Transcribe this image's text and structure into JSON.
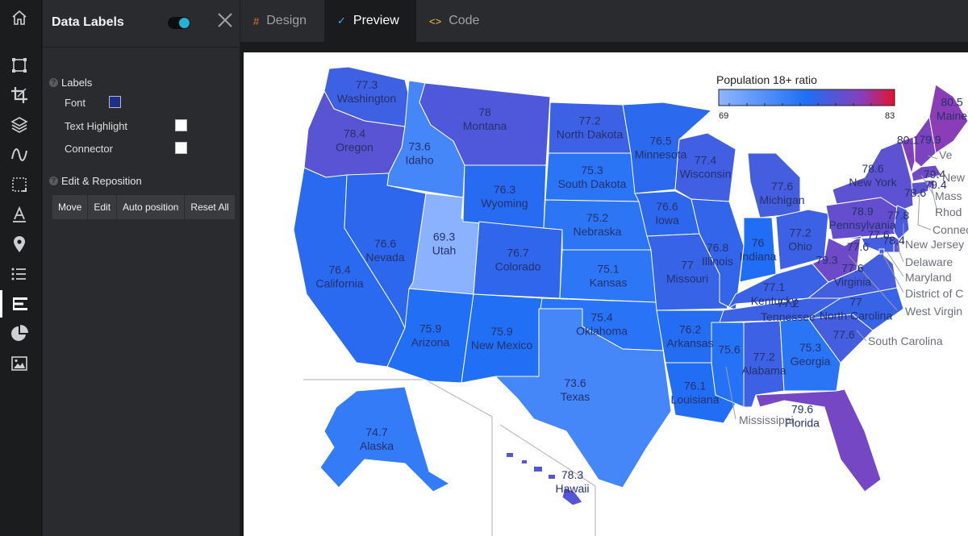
{
  "panel": {
    "title": "Data Labels",
    "toggle_on": true,
    "labels_section": "Labels",
    "font_label": "Font",
    "font_color": "#1f2f86",
    "text_highlight_label": "Text Highlight",
    "text_highlight_color": "#ffffff",
    "connector_label": "Connector",
    "connector_color": "#ffffff",
    "edit_section": "Edit & Reposition",
    "buttons": [
      "Move",
      "Edit",
      "Auto position",
      "Reset All"
    ]
  },
  "tabs": [
    {
      "label": "Design",
      "icon": "#",
      "icon_color": "#e8742a",
      "active": false
    },
    {
      "label": "Preview",
      "icon": "✓",
      "icon_color": "#3fa9f5",
      "active": true
    },
    {
      "label": "Code",
      "icon": "<>",
      "icon_color": "#f5c342",
      "active": false
    }
  ],
  "rail_icons": [
    "home-icon",
    "frame-icon",
    "crop-icon",
    "layers-icon",
    "curve-icon",
    "selection-icon",
    "text-icon",
    "pin-icon",
    "list-icon",
    "data-labels-icon",
    "pie-chart-icon",
    "image-icon"
  ],
  "legend": {
    "title": "Population 18+ ratio",
    "min": 69,
    "max": 83,
    "min_label": "69",
    "max_label": "83",
    "colors": [
      "#8fb5ff",
      "#1f6ef5",
      "#8a3db8",
      "#e8102a"
    ]
  },
  "states": [
    {
      "name": "Washington",
      "value": 77.3
    },
    {
      "name": "Oregon",
      "value": 78.4
    },
    {
      "name": "California",
      "value": 76.4
    },
    {
      "name": "Idaho",
      "value": 73.6
    },
    {
      "name": "Nevada",
      "value": 76.6
    },
    {
      "name": "Utah",
      "value": 69.3
    },
    {
      "name": "Arizona",
      "value": 75.9
    },
    {
      "name": "Montana",
      "value": 78
    },
    {
      "name": "Wyoming",
      "value": 76.3
    },
    {
      "name": "Colorado",
      "value": 76.7
    },
    {
      "name": "New Mexico",
      "value": 75.9
    },
    {
      "name": "North Dakota",
      "value": 77.2
    },
    {
      "name": "South Dakota",
      "value": 75.3
    },
    {
      "name": "Nebraska",
      "value": 75.2
    },
    {
      "name": "Kansas",
      "value": 75.1
    },
    {
      "name": "Oklahoma",
      "value": 75.4
    },
    {
      "name": "Texas",
      "value": 73.6
    },
    {
      "name": "Minnesota",
      "value": 76.5
    },
    {
      "name": "Iowa",
      "value": 76.6
    },
    {
      "name": "Missouri",
      "value": 77
    },
    {
      "name": "Arkansas",
      "value": 76.2
    },
    {
      "name": "Louisiana",
      "value": 76.1
    },
    {
      "name": "Wisconsin",
      "value": 77.4
    },
    {
      "name": "Illinois",
      "value": 76.8
    },
    {
      "name": "Michigan",
      "value": 77.6
    },
    {
      "name": "Indiana",
      "value": 76
    },
    {
      "name": "Ohio",
      "value": 77.2
    },
    {
      "name": "Kentucky",
      "value": 77.1
    },
    {
      "name": "Tennessee",
      "value": 77.2
    },
    {
      "name": "Mississippi",
      "value": 75.6
    },
    {
      "name": "Alabama",
      "value": 77.2
    },
    {
      "name": "Georgia",
      "value": 75.3
    },
    {
      "name": "Florida",
      "value": 79.6
    },
    {
      "name": "South Carolina",
      "value": 77.6
    },
    {
      "name": "North Carolina",
      "value": 77
    },
    {
      "name": "Virginia",
      "value": 77.6
    },
    {
      "name": "West Virginia",
      "value": 79.3
    },
    {
      "name": "Pennsylvania",
      "value": 78.9
    },
    {
      "name": "New York",
      "value": 78.6
    },
    {
      "name": "Maine",
      "value": 80.5
    },
    {
      "name": "Vermont",
      "value": 80.1
    },
    {
      "name": "New Hampshire",
      "value": 79.9
    },
    {
      "name": "Massachusetts",
      "value": 79.4
    },
    {
      "name": "Rhode Island",
      "value": 79.4
    },
    {
      "name": "Connecticut",
      "value": 78.6
    },
    {
      "name": "New Jersey",
      "value": 77.8
    },
    {
      "name": "Delaware",
      "value": 78.4
    },
    {
      "name": "Maryland",
      "value": 77.6
    },
    {
      "name": "District of Columbia",
      "value": 77.6
    },
    {
      "name": "Alaska",
      "value": 74.7
    },
    {
      "name": "Hawaii",
      "value": 78.3
    }
  ],
  "callouts": [
    "Ve",
    "New",
    "Mass",
    "Rhod",
    "Connect",
    "New Jersey",
    "Delaware",
    "Maryland",
    "District of C",
    "West Virgin",
    "South Carolina",
    "Mississippi"
  ]
}
